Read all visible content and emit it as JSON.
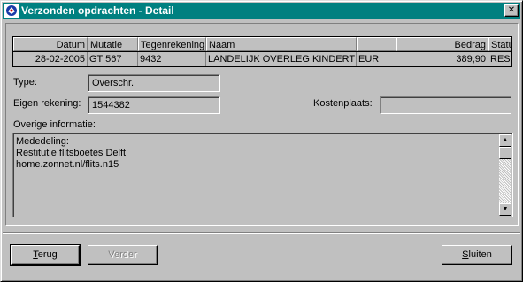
{
  "window": {
    "title": "Verzonden opdrachten - Detail",
    "close_glyph": "✕"
  },
  "grid": {
    "columns": [
      "Datum",
      "Mutatie",
      "Tegenrekening",
      "Naam",
      "",
      "Bedrag",
      "Status"
    ],
    "row": [
      "28-02-2005",
      "GT 567",
      "9432",
      "LANDELIJK OVERLEG KINDERTI",
      "EUR",
      "389,90",
      "RES"
    ]
  },
  "form": {
    "type_label": "Type:",
    "type_value": "Overschr.",
    "eigen_label": "Eigen rekening:",
    "eigen_value": "1544382",
    "kosten_label": "Kostenplaats:",
    "kosten_value": "",
    "overige_label": "Overige informatie:",
    "memo_lines": [
      "Mededeling:",
      "Restitutie flitsboetes Delft",
      "home.zonnet.nl/flits.n15"
    ]
  },
  "buttons": {
    "back_mnemonic": "T",
    "back_rest": "erug",
    "next_label": "Verder",
    "close_mnemonic": "S",
    "close_rest": "luiten"
  },
  "icons": {
    "app": "app-logo-icon",
    "up": "▲",
    "down": "▼"
  }
}
